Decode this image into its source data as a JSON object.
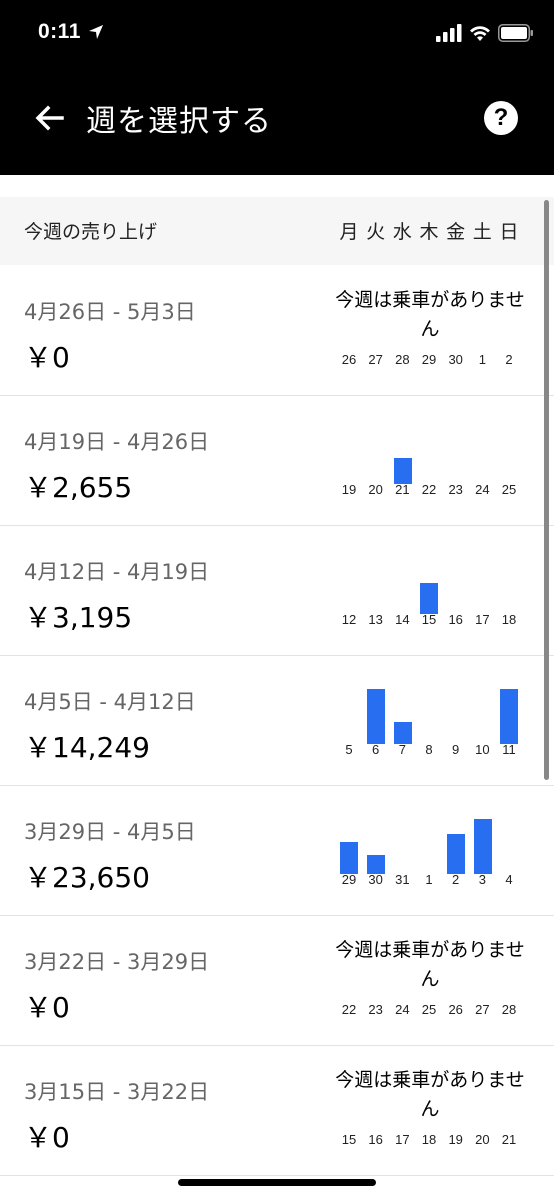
{
  "status_bar": {
    "time": "0:11"
  },
  "header": {
    "title": "週を選択する",
    "help_symbol": "?"
  },
  "earnings_header": {
    "label": "今週の売り上げ",
    "weekdays": [
      "月",
      "火",
      "水",
      "木",
      "金",
      "土",
      "日"
    ]
  },
  "no_rides_text": "今週は乗車がありません",
  "weeks": [
    {
      "range": "4月26日 - 5月3日",
      "amount": "￥0",
      "no_rides": true,
      "days": [
        "26",
        "27",
        "28",
        "29",
        "30",
        "1",
        "2"
      ],
      "bar_values": [
        0,
        0,
        0,
        0,
        0,
        0,
        0
      ]
    },
    {
      "range": "4月19日 - 4月26日",
      "amount": "￥2,655",
      "no_rides": false,
      "days": [
        "19",
        "20",
        "21",
        "22",
        "23",
        "24",
        "25"
      ],
      "bar_values": [
        0,
        0,
        2655,
        0,
        0,
        0,
        0
      ]
    },
    {
      "range": "4月12日 - 4月19日",
      "amount": "￥3,195",
      "no_rides": false,
      "days": [
        "12",
        "13",
        "14",
        "15",
        "16",
        "17",
        "18"
      ],
      "bar_values": [
        0,
        0,
        0,
        3195,
        0,
        0,
        0
      ]
    },
    {
      "range": "4月5日 - 4月12日",
      "amount": "￥14,249",
      "no_rides": false,
      "days": [
        "5",
        "6",
        "7",
        "8",
        "9",
        "10",
        "11"
      ],
      "bar_values": [
        0,
        5600,
        2200,
        0,
        0,
        0,
        5600
      ]
    },
    {
      "range": "3月29日 - 4月5日",
      "amount": "￥23,650",
      "no_rides": false,
      "days": [
        "29",
        "30",
        "31",
        "1",
        "2",
        "3",
        "4"
      ],
      "bar_values": [
        3300,
        1900,
        0,
        0,
        4100,
        5600,
        0
      ]
    },
    {
      "range": "3月22日 - 3月29日",
      "amount": "￥0",
      "no_rides": true,
      "days": [
        "22",
        "23",
        "24",
        "25",
        "26",
        "27",
        "28"
      ],
      "bar_values": [
        0,
        0,
        0,
        0,
        0,
        0,
        0
      ]
    },
    {
      "range": "3月15日 - 3月22日",
      "amount": "￥0",
      "no_rides": true,
      "days": [
        "15",
        "16",
        "17",
        "18",
        "19",
        "20",
        "21"
      ],
      "bar_values": [
        0,
        0,
        0,
        0,
        0,
        0,
        0
      ]
    }
  ],
  "colors": {
    "bar": "#276ef1",
    "header_bg": "#000000"
  },
  "icons": {
    "back": "arrow-left-icon",
    "help": "help-circle-icon",
    "location": "location-arrow-icon",
    "signal": "cellular-signal-icon",
    "wifi": "wifi-icon",
    "battery": "battery-icon"
  }
}
